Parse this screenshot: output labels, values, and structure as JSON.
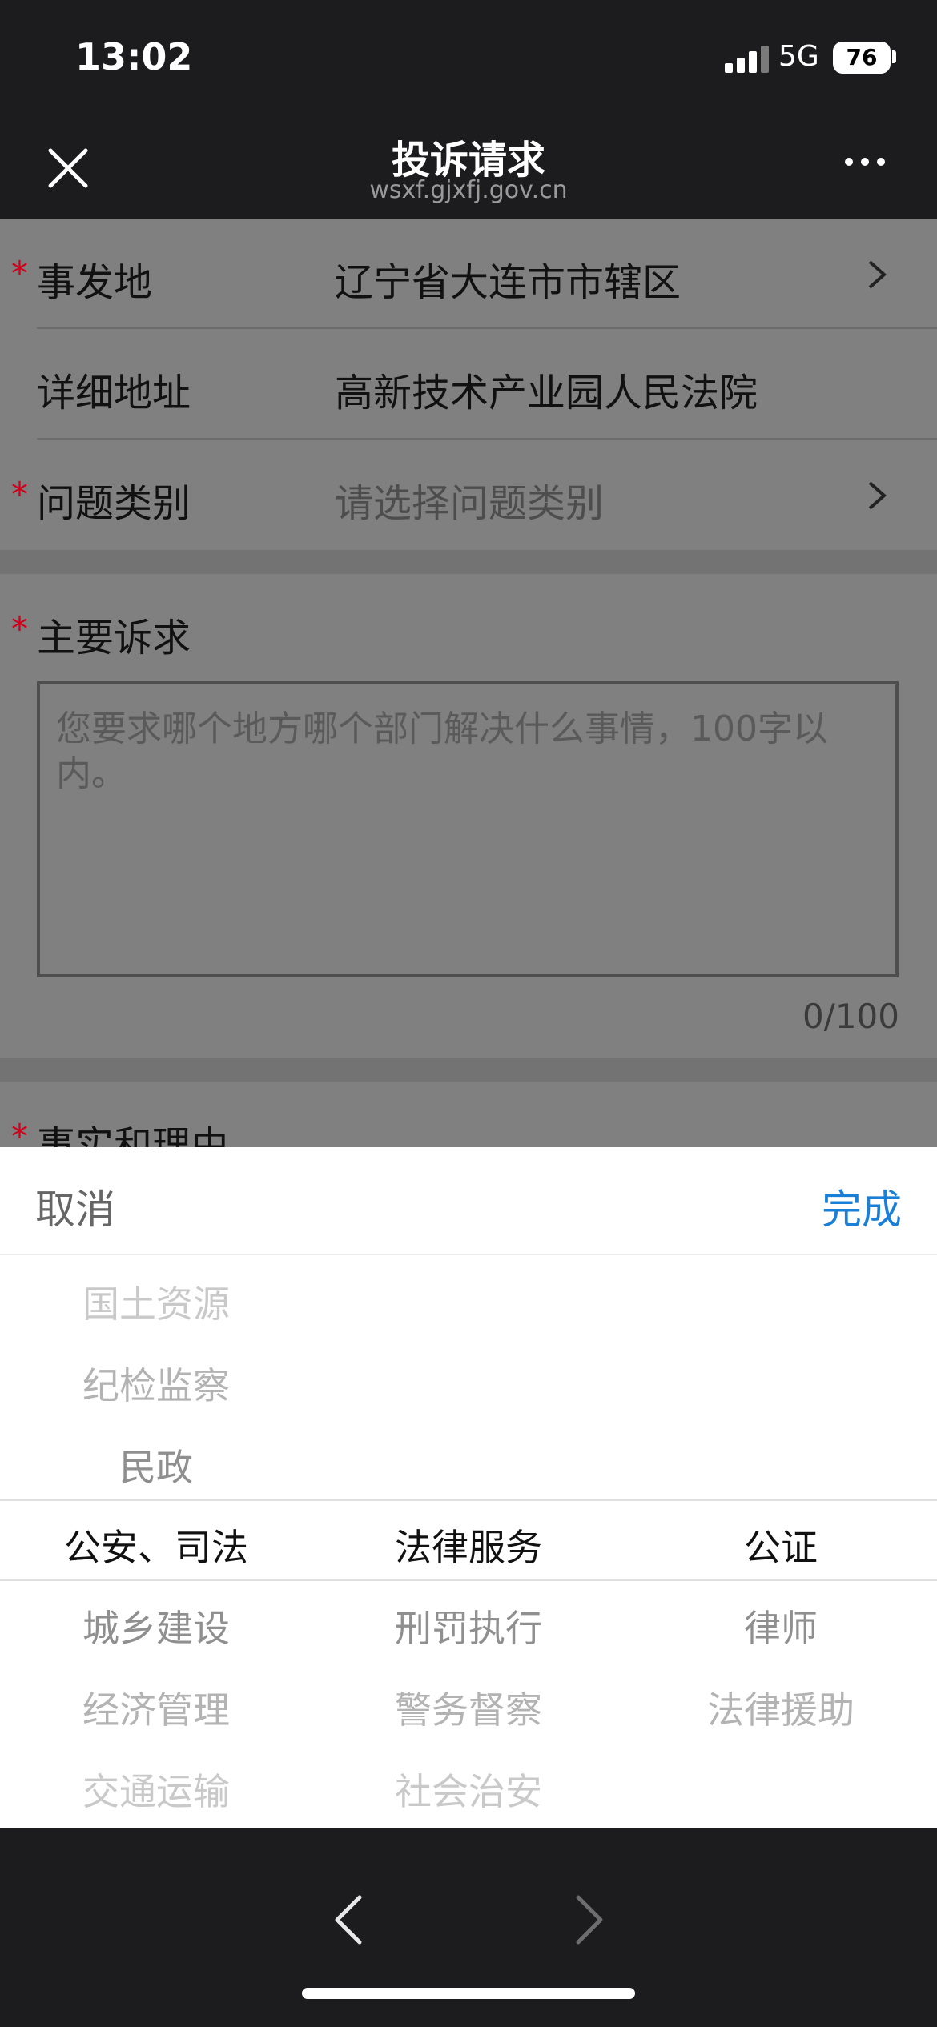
{
  "status_bar": {
    "time": "13:02",
    "network": "5G",
    "battery": "76"
  },
  "nav": {
    "title": "投诉请求",
    "subtitle": "wsxf.gjxfj.gov.cn"
  },
  "form": {
    "location": {
      "required": "*",
      "label": "事发地",
      "value": "辽宁省大连市市辖区"
    },
    "address": {
      "label": "详细地址",
      "value": "高新技术产业园人民法院"
    },
    "category": {
      "required": "*",
      "label": "问题类别",
      "placeholder": "请选择问题类别"
    },
    "appeal": {
      "required": "*",
      "label": "主要诉求",
      "placeholder": "您要求哪个地方哪个部门解决什么事情，100字以内。",
      "count": "0/100"
    },
    "facts": {
      "required": "*",
      "label": "事实和理由"
    }
  },
  "picker": {
    "cancel": "取消",
    "done": "完成",
    "col1": [
      "国土资源",
      "纪检监察",
      "民政",
      "公安、司法",
      "城乡建设",
      "经济管理",
      "交通运输"
    ],
    "col2": [
      "法律服务",
      "刑罚执行",
      "警务督察",
      "社会治安"
    ],
    "col3": [
      "公证",
      "律师",
      "法律援助"
    ]
  },
  "icons": {
    "close": "close-icon",
    "more": "more-icon",
    "back": "chevron-left-icon",
    "forward": "chevron-right-icon"
  }
}
